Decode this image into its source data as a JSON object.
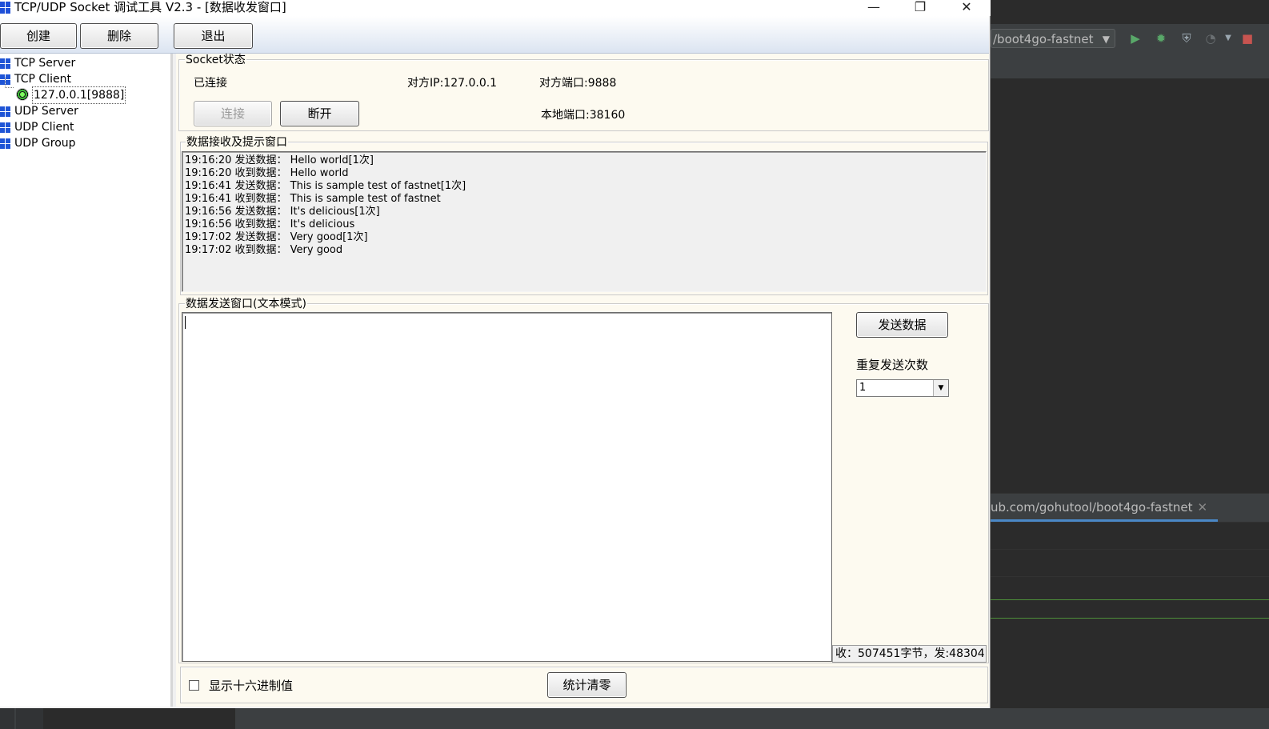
{
  "window": {
    "title": "TCP/UDP Socket 调试工具 V2.3 - [数据收发窗口]",
    "minimize_glyph": "—",
    "maximize_glyph": "❐",
    "close_glyph": "✕"
  },
  "toolbar": {
    "create_label": "创建",
    "delete_label": "删除",
    "exit_label": "退出"
  },
  "tree": {
    "items": [
      {
        "label": "TCP Server"
      },
      {
        "label": "TCP Client"
      },
      {
        "label": "UDP Server"
      },
      {
        "label": "UDP Client"
      },
      {
        "label": "UDP Group"
      }
    ],
    "child": {
      "label": "127.0.0.1[9888]",
      "status_color": "#3fc23a"
    }
  },
  "socket": {
    "legend": "Socket状态",
    "state": "已连接",
    "remote_ip": "对方IP:127.0.0.1",
    "remote_port": "对方端口:9888",
    "local_port": "本地端口:38160",
    "connect_label": "连接",
    "disconnect_label": "断开"
  },
  "recv": {
    "legend": "数据接收及提示窗口",
    "lines": [
      "19:16:20 发送数据：  Hello world[1次]",
      "19:16:20 收到数据：  Hello world",
      "19:16:41 发送数据：  This is sample test of fastnet[1次]",
      "19:16:41 收到数据：  This is sample test of fastnet",
      "19:16:56 发送数据：  It's delicious[1次]",
      "19:16:56 收到数据：  It's delicious",
      "19:17:02 发送数据：  Very good[1次]",
      "19:17:02 收到数据：  Very good"
    ]
  },
  "send": {
    "legend": "数据发送窗口(文本模式)",
    "value": "",
    "send_label": "发送数据",
    "repeat_label": "重复发送次数",
    "repeat_value": "1",
    "counter_text": "收：507451字节，发:48304",
    "hex_label": "显示十六进制值",
    "hex_checked": false,
    "reset_label": "统计清零"
  },
  "ide": {
    "run_config": "/boot4go-fastnet",
    "tab_url": "ub.com/gohutool/boot4go-fastnet",
    "tab_close": "✕",
    "colors": {
      "bg": "#2b2b2b",
      "panel": "#3c3f41",
      "run": "#59a869",
      "stop": "#c75450",
      "accent": "#4a88c7"
    }
  }
}
